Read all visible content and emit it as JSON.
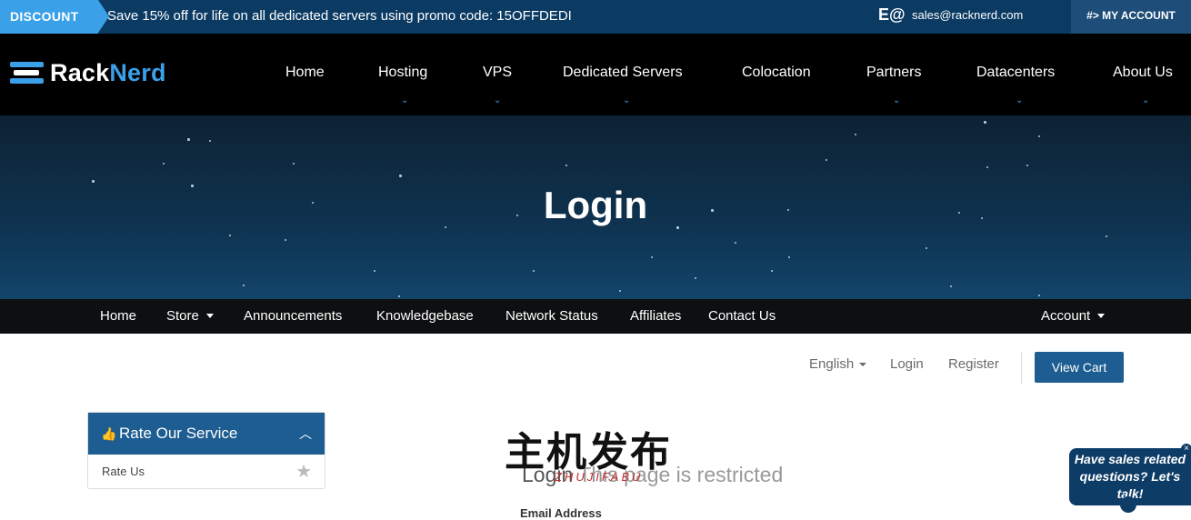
{
  "promo": {
    "badge": "DISCOUNT",
    "text": "Save 15% off for life on all dedicated servers using promo code: 15OFFDEDI",
    "contact_icon": "E@",
    "email": "sales@racknerd.com",
    "account": "#> MY ACCOUNT"
  },
  "brand": {
    "part1": "Rack",
    "part2": "Nerd",
    "accent": "#3aa0e8"
  },
  "mainnav": {
    "items": [
      {
        "label": "Home",
        "has_dropdown": false
      },
      {
        "label": "Hosting",
        "has_dropdown": true
      },
      {
        "label": "VPS",
        "has_dropdown": true
      },
      {
        "label": "Dedicated Servers",
        "has_dropdown": true
      },
      {
        "label": "Colocation",
        "has_dropdown": false
      },
      {
        "label": "Partners",
        "has_dropdown": true
      },
      {
        "label": "Datacenters",
        "has_dropdown": true
      },
      {
        "label": "About Us",
        "has_dropdown": true
      }
    ],
    "chevron": "⌄"
  },
  "hero": {
    "title": "Login"
  },
  "subnav": {
    "items": [
      "Home",
      "Store",
      "Announcements",
      "Knowledgebase",
      "Network Status",
      "Affiliates",
      "Contact Us"
    ],
    "account": "Account"
  },
  "toplinks": {
    "language": "English",
    "login": "Login",
    "register": "Register",
    "view_cart": "View Cart"
  },
  "sidebar": {
    "title": "Rate Our Service",
    "thumb_icon": "👍",
    "collapse_icon": "︿",
    "item": "Rate Us",
    "star_icon": "★"
  },
  "content": {
    "title_part1": "Login",
    "title_part2": "This page is restricted",
    "email_label": "Email Address"
  },
  "watermark": {
    "cn": "主机发布",
    "en": "ZHUJIFABU"
  },
  "chat": {
    "text": "Have sales related questions? Let's talk!",
    "close": "×"
  }
}
